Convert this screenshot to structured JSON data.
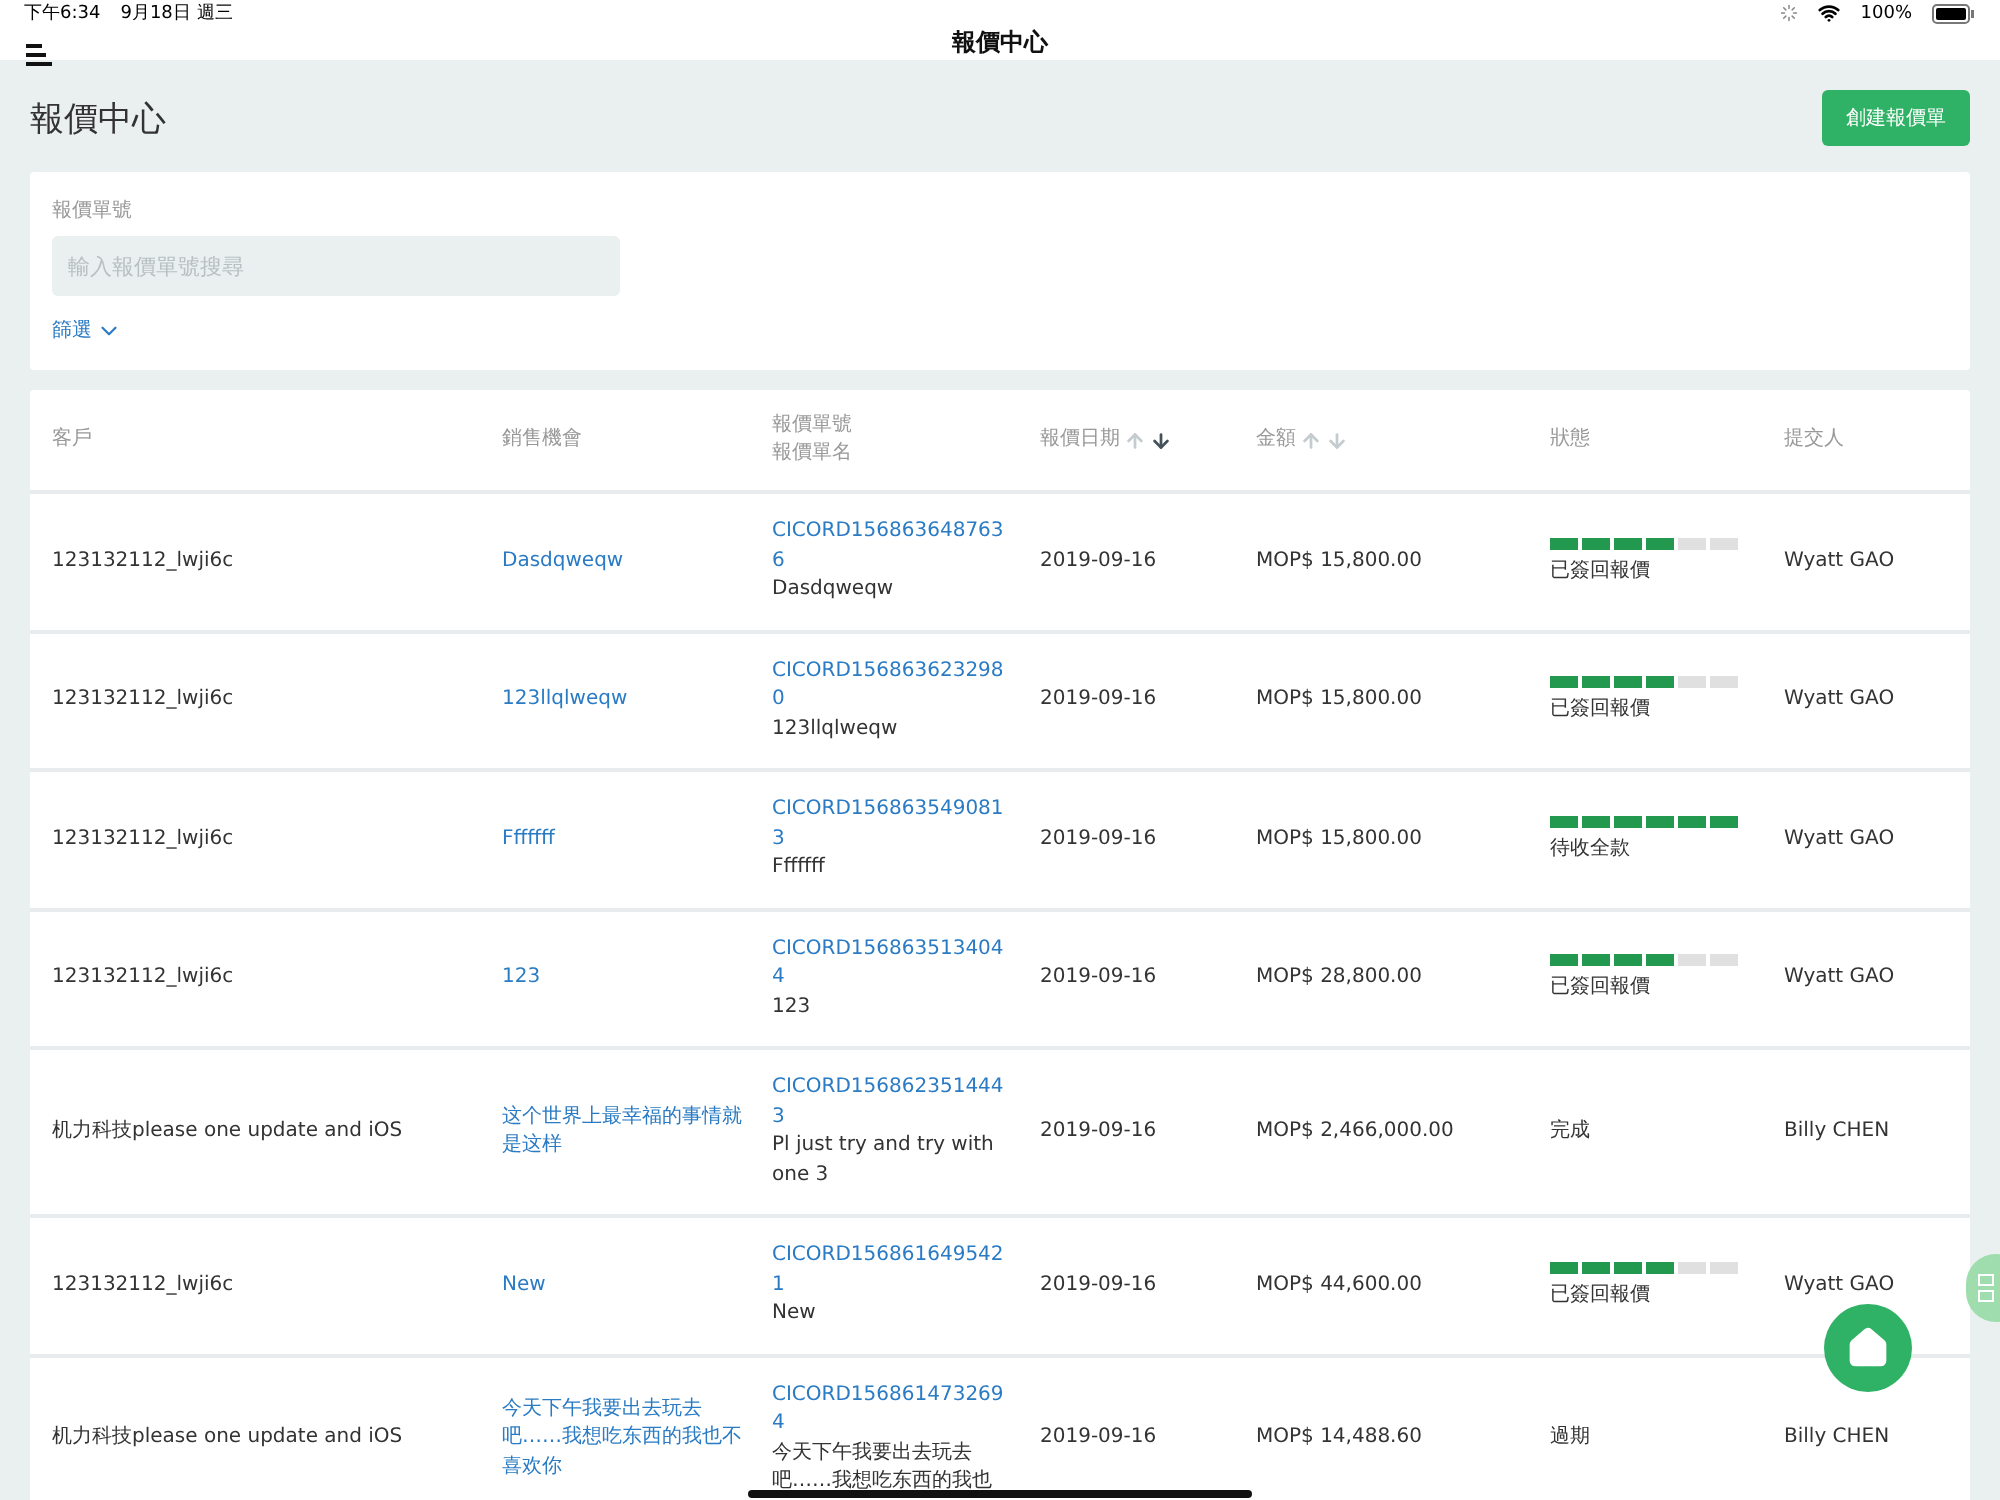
{
  "status_bar": {
    "time": "下午6:34",
    "date": "9月18日 週三",
    "battery": "100%"
  },
  "nav_bar": {
    "title": "報價中心"
  },
  "page": {
    "title": "報價中心",
    "create_button": "創建報價單"
  },
  "search": {
    "label": "報價單號",
    "placeholder": "輸入報價單號搜尋",
    "filter_toggle": "篩選",
    "filter_expanded": false
  },
  "table": {
    "columns": [
      {
        "label": "客戶"
      },
      {
        "label": "銷售機會"
      },
      {
        "label": "報價單號",
        "label_2": "報價單名"
      },
      {
        "label": "報價日期",
        "sort_asc": false,
        "sort_desc": true
      },
      {
        "label": "金額",
        "sort_asc": false,
        "sort_desc": false
      },
      {
        "label": "狀態"
      },
      {
        "label": "提交人"
      }
    ],
    "rows": [
      {
        "customer": "123132112_lwji6c",
        "opportunity": "Dasdqweqw",
        "quote_no": "CICORD156863648763 6",
        "quote_name": "Dasdqweqw",
        "date": "2019-09-16",
        "amount": "MOP$ 15,800.00",
        "status": "已簽回報價",
        "level": 0.667,
        "submitter": "Wyatt GAO"
      },
      {
        "customer": "123132112_lwji6c",
        "opportunity": "123llqlweqw",
        "quote_no": "CICORD156863623298 0",
        "quote_name": "123llqlweqw",
        "date": "2019-09-16",
        "amount": "MOP$ 15,800.00",
        "status": "已簽回報價",
        "level": 0.667,
        "submitter": "Wyatt GAO"
      },
      {
        "customer": "123132112_lwji6c",
        "opportunity": "Fffffff",
        "quote_no": "CICORD156863549081 3",
        "quote_name": "Fffffff",
        "date": "2019-09-16",
        "amount": "MOP$ 15,800.00",
        "status": "待收全款",
        "level": 1,
        "submitter": "Wyatt GAO"
      },
      {
        "customer": "123132112_lwji6c",
        "opportunity": "123",
        "quote_no": "CICORD156863513404 4",
        "quote_name": "123",
        "date": "2019-09-16",
        "amount": "MOP$ 28,800.00",
        "status": "已簽回報價",
        "level": 0.667,
        "submitter": "Wyatt GAO"
      },
      {
        "customer": "机力科技please one update and iOS",
        "opportunity": "这个世界上最幸福的事情就是这样",
        "quote_no": "CICORD156862351444 3",
        "quote_name": "Pl just try and try with one 3",
        "date": "2019-09-16",
        "amount": "MOP$ 2,466,000.00",
        "status": "完成",
        "submitter": "Billy CHEN"
      },
      {
        "customer": "123132112_lwji6c",
        "opportunity": "New",
        "quote_no": "CICORD156861649542 1",
        "quote_name": "New",
        "date": "2019-09-16",
        "amount": "MOP$ 44,600.00",
        "status": "已簽回報價",
        "level": 0.667,
        "submitter": "Wyatt GAO"
      },
      {
        "customer": "机力科技please one update and iOS",
        "opportunity": "今天下午我要出去玩去吧……我想吃东西的我也不喜欢你",
        "quote_no": "CICORD156861473269 4",
        "quote_name": "今天下午我要出去玩去吧……我想吃东西的我也",
        "date": "2019-09-16",
        "amount": "MOP$ 14,488.60",
        "status": "過期",
        "submitter": "Billy CHEN"
      }
    ]
  }
}
